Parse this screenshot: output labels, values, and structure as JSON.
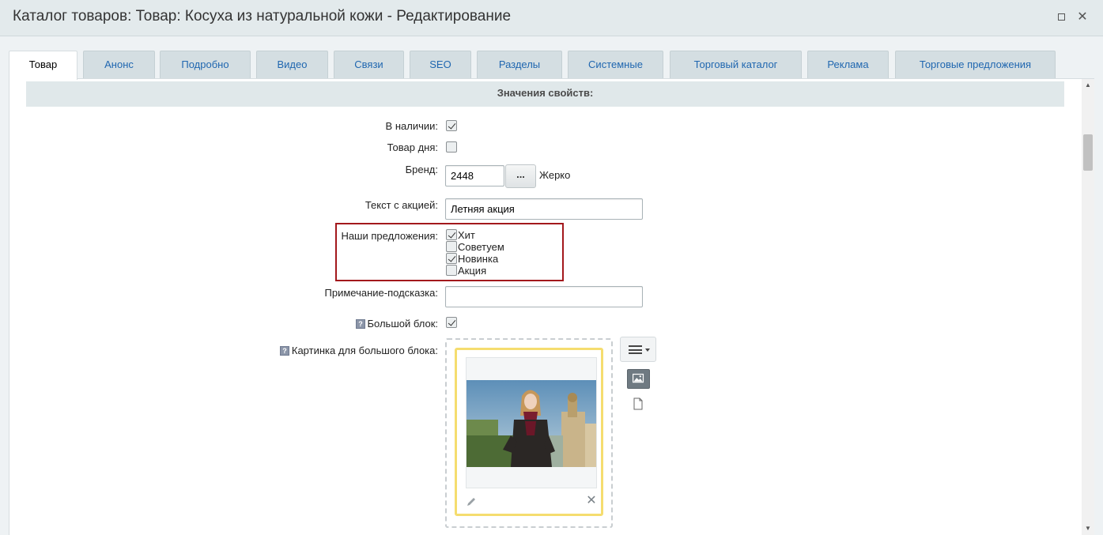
{
  "window": {
    "title": "Каталог товаров: Товар: Косуха из натуральной кожи - Редактирование",
    "restore_glyph": "",
    "close_glyph": "✕"
  },
  "tabs": [
    {
      "label": "Товар",
      "active": true
    },
    {
      "label": "Анонс"
    },
    {
      "label": "Подробно"
    },
    {
      "label": "Видео"
    },
    {
      "label": "Связи"
    },
    {
      "label": "SEO"
    },
    {
      "label": "Разделы"
    },
    {
      "label": "Системные"
    },
    {
      "label": "Торговый каталог"
    },
    {
      "label": "Реклама"
    },
    {
      "label": "Торговые предложения"
    }
  ],
  "section": {
    "title": "Значения свойств:"
  },
  "fields": {
    "in_stock": {
      "label": "В наличии:",
      "checked": true
    },
    "product_of_day": {
      "label": "Товар дня:",
      "checked": false
    },
    "brand": {
      "label": "Бренд:",
      "value": "2448",
      "button_label": "...",
      "name": "Жерко"
    },
    "promo_text": {
      "label": "Текст с акцией:",
      "value": "Летняя акция"
    },
    "offers": {
      "label": "Наши предложения:",
      "options": [
        {
          "label": "Хит",
          "checked": true
        },
        {
          "label": "Советуем",
          "checked": false
        },
        {
          "label": "Новинка",
          "checked": true
        },
        {
          "label": "Акция",
          "checked": false
        }
      ]
    },
    "hint_note": {
      "label": "Примечание-подсказка:",
      "value": ""
    },
    "big_block": {
      "label": "Большой блок:",
      "checked": true,
      "help_glyph": "?"
    },
    "big_block_image": {
      "label": "Картинка для большого блока:",
      "help_glyph": "?",
      "remove_glyph": "✕"
    }
  },
  "scrollbar": {
    "up_glyph": "▲",
    "down_glyph": "▼"
  },
  "colors": {
    "accent_link": "#2067b0",
    "highlight_border": "#a3181c",
    "image_card_border": "#f5dd6f"
  },
  "icons": {
    "title_restore": "restore-window-icon",
    "title_close": "close-icon",
    "help": "question-mark-icon",
    "edit": "pencil-icon",
    "remove": "close-icon",
    "menu": "hamburger-menu-icon",
    "image_mode": "image-icon",
    "file_mode": "file-icon"
  }
}
